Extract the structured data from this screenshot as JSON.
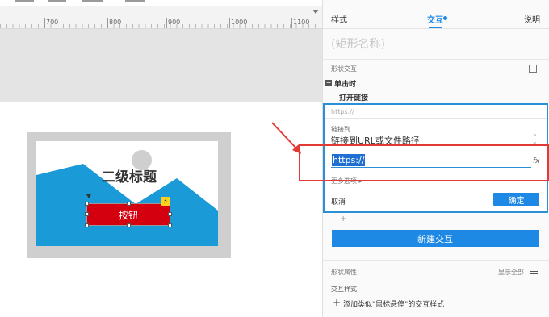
{
  "ruler": {
    "ticks": [
      "700",
      "800",
      "900",
      "1000",
      "1100"
    ]
  },
  "canvas": {
    "heading": "二级标题",
    "button_label": "按钮",
    "badge_icon": "lightning-icon"
  },
  "panel": {
    "tabs": {
      "style": "样式",
      "interaction": "交互",
      "notes": "说明"
    },
    "shape_name_placeholder": "(矩形名称)",
    "shape_interaction_label": "形状交互",
    "event": {
      "collapse_glyph": "−",
      "label": "单击时"
    },
    "action": "打开链接",
    "link_editor": {
      "preview": "https://",
      "link_to_label": "链接到",
      "link_type": "链接到URL或文件路径",
      "url_value": "https://",
      "fx": "fx",
      "more_options": "更多选项 ▸",
      "cancel": "取消",
      "ok": "确定"
    },
    "plus": "+",
    "new_interaction": "新建交互",
    "shape_properties": "形状属性",
    "show_all": "显示全部",
    "interaction_styles": "交互样式",
    "add_style_plus": "+",
    "add_style": "添加类似\"鼠标悬停\"的交互样式"
  },
  "colors": {
    "accent": "#1e88e5",
    "highlight": "#e53935",
    "button_red": "#d4000f",
    "mountain": "#1a9ad6"
  }
}
